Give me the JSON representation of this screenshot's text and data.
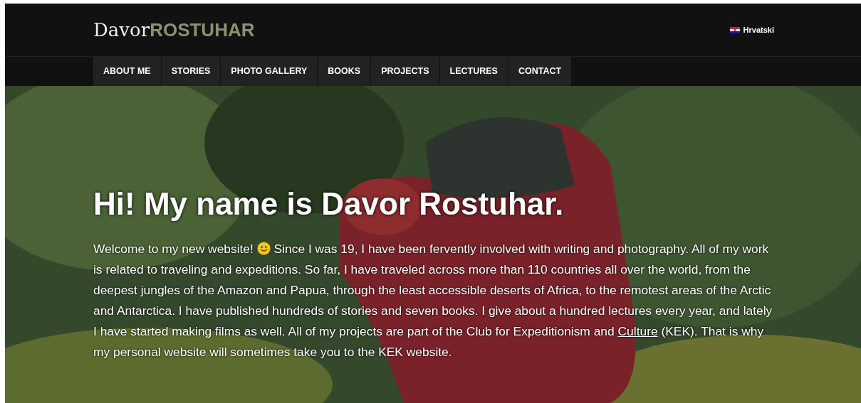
{
  "logo": {
    "first": "Davor",
    "last": "ROSTUHAR"
  },
  "language": {
    "label": "Hrvatski"
  },
  "nav": [
    {
      "label": "ABOUT ME"
    },
    {
      "label": "STORIES"
    },
    {
      "label": "PHOTO GALLERY"
    },
    {
      "label": "BOOKS"
    },
    {
      "label": "PROJECTS"
    },
    {
      "label": "LECTURES"
    },
    {
      "label": "CONTACT"
    }
  ],
  "hero": {
    "heading": "Hi! My name is Davor Rostuhar.",
    "paragraph": [
      {
        "kind": "text",
        "text": "Welcome to my new website! "
      },
      {
        "kind": "emoji"
      },
      {
        "kind": "text",
        "text": " Since I was 19, I have been fervently involved with writing and photography. All of my work is related to traveling and expeditions. So far, I have traveled across more than 110 countries all over the world, from the deepest jungles of the Amazon and Papua, through the least accessible deserts of Africa, to the remotest areas of the Arctic and Antarctica. I have published hundreds of stories and seven books. I give about a hundred lectures every year, and lately I have started making films as well. All of my projects are part of the Club for Expeditionism and "
      },
      {
        "kind": "link",
        "text": "Culture"
      },
      {
        "kind": "text",
        "text": " (KEK). That is why my personal website will sometimes take you to the KEK website."
      }
    ]
  }
}
